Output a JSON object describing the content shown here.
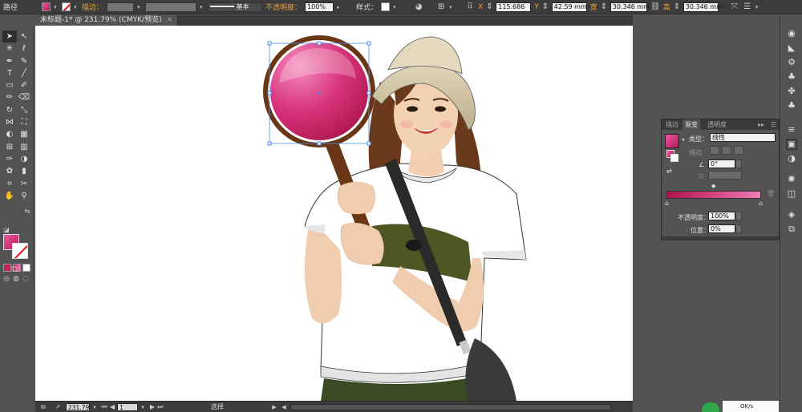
{
  "control_bar": {
    "object_type": "路径",
    "stroke_label": "描边：",
    "stroke_profile": "基本",
    "opacity_label": "不透明度：",
    "opacity_value": "100%",
    "style_label": "样式：",
    "x_label": "X",
    "x_value": "115.686",
    "y_label": "Y",
    "y_value": "42.59 mm",
    "w_label": "宽",
    "w_value": "30.346 mm",
    "h_label": "高",
    "h_value": "30.346 mm",
    "fill_color": "#d9357a"
  },
  "document_tab": {
    "title": "未标题-1* @ 231.79% (CMYK/预览)",
    "close": "×"
  },
  "toolbox": {
    "tools": [
      "selection-tool",
      "direct-selection-tool",
      "magic-wand-tool",
      "lasso-tool",
      "pen-tool",
      "curvature-tool",
      "type-tool",
      "line-segment-tool",
      "rectangle-tool",
      "paintbrush-tool",
      "pencil-tool",
      "eraser-tool",
      "rotate-tool",
      "scale-tool",
      "width-tool",
      "free-transform-tool",
      "shape-builder-tool",
      "perspective-grid-tool",
      "mesh-tool",
      "gradient-tool",
      "eyedropper-tool",
      "blend-tool",
      "symbol-sprayer-tool",
      "column-graph-tool",
      "artboard-tool",
      "slice-tool",
      "hand-tool",
      "zoom-tool"
    ]
  },
  "gradient_panel": {
    "tabs": [
      "描边",
      "渐变",
      "透明度"
    ],
    "active_tab": "渐变",
    "type_label": "类型：",
    "type_value": "线性",
    "stroke_label": "描边",
    "angle_value": "0°",
    "opacity_label": "不透明度：",
    "opacity_value": "100%",
    "location_label": "位置：",
    "location_value": "0%",
    "gradient_start": "#b0124e",
    "gradient_end": "#f07ab8"
  },
  "status_bar": {
    "zoom_value": "231.79",
    "artboard_value": "1",
    "tool_label": "选择"
  },
  "watermark": {
    "text": "OK/s"
  }
}
